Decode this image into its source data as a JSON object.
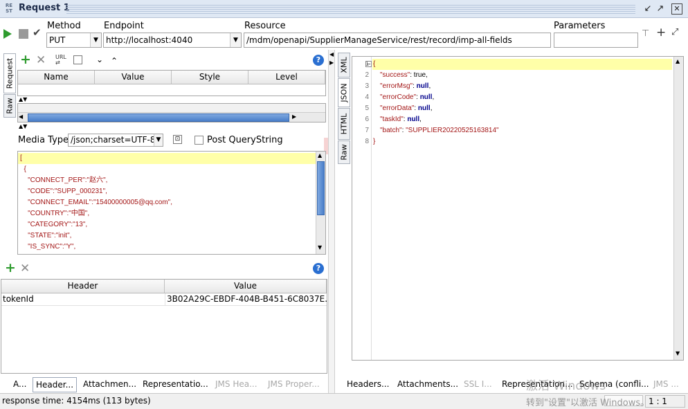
{
  "window": {
    "logo": "RE ST",
    "title": "Request 1",
    "controls": {
      "minimize": "↙",
      "restore": "↗",
      "close": "✕"
    }
  },
  "toolbar": {
    "method_label": "Method",
    "method_value": "PUT",
    "endpoint_label": "Endpoint",
    "endpoint_value": "http://localhost:4040",
    "resource_label": "Resource",
    "resource_value": "/mdm/openapi/SupplierManageService/rest/record/imp-all-fields",
    "parameters_label": "Parameters",
    "parameters_value": ""
  },
  "request_tabs": {
    "request": "Request",
    "raw": "Raw"
  },
  "params_table": {
    "columns": [
      "Name",
      "Value",
      "Style",
      "Level"
    ]
  },
  "media": {
    "label": "Media Type",
    "value": "/json;charset=UTF-8",
    "post_querystring": "Post QueryString",
    "post_querystring_checked": false
  },
  "request_body": {
    "lines": [
      "[",
      "  {",
      "    \"CONNECT_PER\":\"赵六\",",
      "    \"CODE\":\"SUPP_000231\",",
      "    \"CONNECT_EMAIL\":\"15400000005@qq.com\",",
      "    \"COUNTRY\":\"中国\",",
      "    \"CATEGORY\":\"13\",",
      "    \"STATE\":\"init\",",
      "    \"IS_SYNC\":\"Y\","
    ]
  },
  "headers_table": {
    "columns": [
      "Header",
      "Value"
    ],
    "rows": [
      {
        "header": "tokenId",
        "value": "3B02A29C-EBDF-404B-B451-6C8037E..."
      }
    ]
  },
  "left_bottom_tabs": [
    "A...",
    "Header...",
    "Attachmen...",
    "Representatio...",
    "JMS Hea...",
    "JMS Proper..."
  ],
  "response_tabs": {
    "xml": "XML",
    "json": "JSON",
    "html": "HTML",
    "raw": "Raw"
  },
  "response_json": {
    "line_numbers": [
      "1",
      "2",
      "3",
      "4",
      "5",
      "6",
      "7",
      "8"
    ],
    "open": "{",
    "close": "}",
    "fields": [
      {
        "key": "\"success\"",
        "value": "true",
        "kind": "plain"
      },
      {
        "key": "\"errorMsg\"",
        "value": "null",
        "kind": "kw"
      },
      {
        "key": "\"errorCode\"",
        "value": "null",
        "kind": "kw"
      },
      {
        "key": "\"errorData\"",
        "value": "null",
        "kind": "kw"
      },
      {
        "key": "\"taskId\"",
        "value": "null",
        "kind": "kw"
      },
      {
        "key": "\"batch\"",
        "value": "\"SUPPLIER20220525163814\"",
        "kind": "str"
      }
    ]
  },
  "right_bottom_tabs": [
    "Headers...",
    "Attachments...",
    "SSL I...",
    "Representation...",
    "Schema (confli...",
    "JMS ..."
  ],
  "status": {
    "response_time": "response time: 4154ms (113 bytes)",
    "position": "1 : 1"
  },
  "watermark": {
    "line1": "激活 Windows",
    "line2": "转到\"设置\"以激活 Windows。"
  },
  "colors": {
    "current_line": "#ffffa8",
    "title_bar": "#dfe8f4",
    "add_green": "#2e9b2e",
    "help_blue": "#2a6fd1"
  }
}
